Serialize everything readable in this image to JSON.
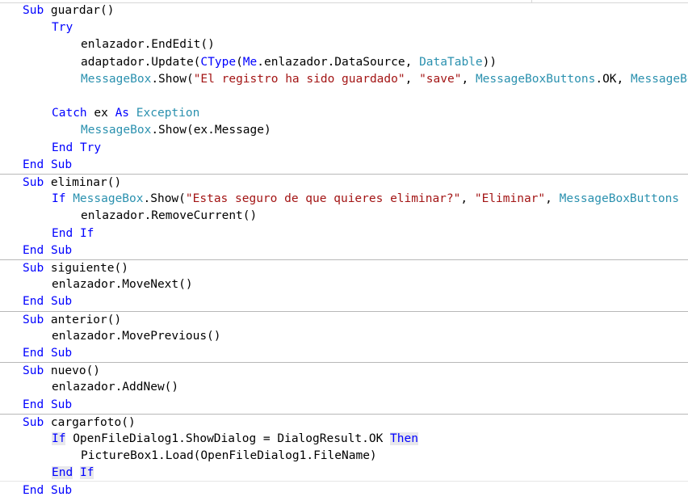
{
  "editor": {
    "colors": {
      "keyword": "#0000ff",
      "type": "#2b91af",
      "string": "#a31515",
      "text": "#000000",
      "separator": "#b8b8b8",
      "highlight": "#e8e8ec"
    },
    "lines": [
      {
        "indent": 0,
        "sep": false,
        "tokens": [
          {
            "t": "Sub",
            "k": "kw"
          },
          {
            "t": " guardar()",
            "k": "plain"
          }
        ]
      },
      {
        "indent": 1,
        "sep": false,
        "tokens": [
          {
            "t": "Try",
            "k": "kw"
          }
        ]
      },
      {
        "indent": 2,
        "sep": false,
        "tokens": [
          {
            "t": "enlazador.EndEdit()",
            "k": "plain"
          }
        ]
      },
      {
        "indent": 2,
        "sep": false,
        "tokens": [
          {
            "t": "adaptador.Update(",
            "k": "plain"
          },
          {
            "t": "CType",
            "k": "kw"
          },
          {
            "t": "(",
            "k": "plain"
          },
          {
            "t": "Me",
            "k": "kw"
          },
          {
            "t": ".enlazador.DataSource, ",
            "k": "plain"
          },
          {
            "t": "DataTable",
            "k": "type"
          },
          {
            "t": "))",
            "k": "plain"
          }
        ]
      },
      {
        "indent": 2,
        "sep": false,
        "tokens": [
          {
            "t": "MessageBox",
            "k": "type"
          },
          {
            "t": ".Show(",
            "k": "plain"
          },
          {
            "t": "\"El registro ha sido guardado\"",
            "k": "str"
          },
          {
            "t": ", ",
            "k": "plain"
          },
          {
            "t": "\"save\"",
            "k": "str"
          },
          {
            "t": ", ",
            "k": "plain"
          },
          {
            "t": "MessageBoxButtons",
            "k": "type"
          },
          {
            "t": ".OK, ",
            "k": "plain"
          },
          {
            "t": "MessageBoxIcon",
            "k": "type"
          }
        ]
      },
      {
        "indent": 0,
        "sep": false,
        "tokens": []
      },
      {
        "indent": 1,
        "sep": false,
        "tokens": [
          {
            "t": "Catch",
            "k": "kw"
          },
          {
            "t": " ex ",
            "k": "plain"
          },
          {
            "t": "As",
            "k": "kw"
          },
          {
            "t": " ",
            "k": "plain"
          },
          {
            "t": "Exception",
            "k": "type"
          }
        ]
      },
      {
        "indent": 2,
        "sep": false,
        "tokens": [
          {
            "t": "MessageBox",
            "k": "type"
          },
          {
            "t": ".Show(ex.Message)",
            "k": "plain"
          }
        ]
      },
      {
        "indent": 1,
        "sep": false,
        "tokens": [
          {
            "t": "End",
            "k": "kw"
          },
          {
            "t": " ",
            "k": "plain"
          },
          {
            "t": "Try",
            "k": "kw"
          }
        ]
      },
      {
        "indent": 0,
        "sep": false,
        "tokens": [
          {
            "t": "End",
            "k": "kw"
          },
          {
            "t": " ",
            "k": "plain"
          },
          {
            "t": "Sub",
            "k": "kw"
          }
        ]
      },
      {
        "indent": 0,
        "sep": true,
        "tokens": [
          {
            "t": "Sub",
            "k": "kw"
          },
          {
            "t": " eliminar()",
            "k": "plain"
          }
        ]
      },
      {
        "indent": 1,
        "sep": false,
        "tokens": [
          {
            "t": "If",
            "k": "kw"
          },
          {
            "t": " ",
            "k": "plain"
          },
          {
            "t": "MessageBox",
            "k": "type"
          },
          {
            "t": ".Show(",
            "k": "plain"
          },
          {
            "t": "\"Estas seguro de que quieres eliminar?\"",
            "k": "str"
          },
          {
            "t": ", ",
            "k": "plain"
          },
          {
            "t": "\"Eliminar\"",
            "k": "str"
          },
          {
            "t": ", ",
            "k": "plain"
          },
          {
            "t": "MessageBoxButtons",
            "k": "type"
          }
        ]
      },
      {
        "indent": 2,
        "sep": false,
        "tokens": [
          {
            "t": "enlazador.RemoveCurrent()",
            "k": "plain"
          }
        ]
      },
      {
        "indent": 1,
        "sep": false,
        "tokens": [
          {
            "t": "End",
            "k": "kw"
          },
          {
            "t": " ",
            "k": "plain"
          },
          {
            "t": "If",
            "k": "kw"
          }
        ]
      },
      {
        "indent": 0,
        "sep": false,
        "tokens": [
          {
            "t": "End",
            "k": "kw"
          },
          {
            "t": " ",
            "k": "plain"
          },
          {
            "t": "Sub",
            "k": "kw"
          }
        ]
      },
      {
        "indent": 0,
        "sep": true,
        "tokens": [
          {
            "t": "Sub",
            "k": "kw"
          },
          {
            "t": " siguiente()",
            "k": "plain"
          }
        ]
      },
      {
        "indent": 1,
        "sep": false,
        "tokens": [
          {
            "t": "enlazador.MoveNext()",
            "k": "plain"
          }
        ]
      },
      {
        "indent": 0,
        "sep": false,
        "tokens": [
          {
            "t": "End",
            "k": "kw"
          },
          {
            "t": " ",
            "k": "plain"
          },
          {
            "t": "Sub",
            "k": "kw"
          }
        ]
      },
      {
        "indent": 0,
        "sep": true,
        "tokens": [
          {
            "t": "Sub",
            "k": "kw"
          },
          {
            "t": " anterior()",
            "k": "plain"
          }
        ]
      },
      {
        "indent": 1,
        "sep": false,
        "tokens": [
          {
            "t": "enlazador.MovePrevious()",
            "k": "plain"
          }
        ]
      },
      {
        "indent": 0,
        "sep": false,
        "tokens": [
          {
            "t": "End",
            "k": "kw"
          },
          {
            "t": " ",
            "k": "plain"
          },
          {
            "t": "Sub",
            "k": "kw"
          }
        ]
      },
      {
        "indent": 0,
        "sep": true,
        "tokens": [
          {
            "t": "Sub",
            "k": "kw"
          },
          {
            "t": " nuevo()",
            "k": "plain"
          }
        ]
      },
      {
        "indent": 1,
        "sep": false,
        "tokens": [
          {
            "t": "enlazador.AddNew()",
            "k": "plain"
          }
        ]
      },
      {
        "indent": 0,
        "sep": false,
        "tokens": [
          {
            "t": "End",
            "k": "kw"
          },
          {
            "t": " ",
            "k": "plain"
          },
          {
            "t": "Sub",
            "k": "kw"
          }
        ]
      },
      {
        "indent": 0,
        "sep": true,
        "tokens": [
          {
            "t": "Sub",
            "k": "kw"
          },
          {
            "t": " cargarfoto()",
            "k": "plain"
          }
        ]
      },
      {
        "indent": 1,
        "sep": false,
        "tokens": [
          {
            "t": "If",
            "k": "kw",
            "hl": true
          },
          {
            "t": " OpenFileDialog1.ShowDialog = DialogResult.OK ",
            "k": "plain"
          },
          {
            "t": "Then",
            "k": "kw",
            "hl": true
          }
        ]
      },
      {
        "indent": 2,
        "sep": false,
        "tokens": [
          {
            "t": "PictureBox1.Load(OpenFileDialog1.FileName)",
            "k": "plain"
          }
        ]
      },
      {
        "indent": 1,
        "sep": false,
        "current": true,
        "tokens": [
          {
            "t": "End",
            "k": "kw",
            "hl": true
          },
          {
            "t": " ",
            "k": "plain"
          },
          {
            "t": "If",
            "k": "kw",
            "hl": true
          }
        ]
      },
      {
        "indent": 0,
        "sep": false,
        "tokens": [
          {
            "t": "End",
            "k": "kw"
          },
          {
            "t": " ",
            "k": "plain"
          },
          {
            "t": "Sub",
            "k": "kw"
          }
        ]
      }
    ]
  }
}
